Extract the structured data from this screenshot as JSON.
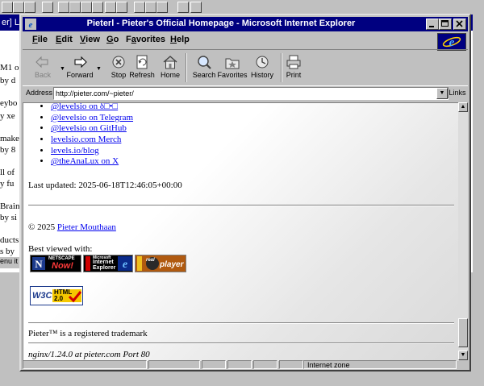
{
  "window": {
    "title": "Pieterl - Pieter's Official Homepage - Microsoft Internet Explorer"
  },
  "background": {
    "title_fragment": "er] Li",
    "lines": [
      "M1 o",
      "by d",
      "eybo",
      "y xe",
      "make",
      "by 8",
      "ll of",
      "y fu",
      "Brain",
      "by si",
      "ducts",
      "s by"
    ],
    "taskbar_text": "enu it"
  },
  "menu": {
    "items": [
      "File",
      "Edit",
      "View",
      "Go",
      "Favorites",
      "Help"
    ],
    "accel": [
      "F",
      "E",
      "V",
      "G",
      "a",
      "H"
    ]
  },
  "toolbar": {
    "back": "Back",
    "forward": "Forward",
    "stop": "Stop",
    "refresh": "Refresh",
    "home": "Home",
    "search": "Search",
    "favorites": "Favorites",
    "history": "History",
    "print": "Print"
  },
  "address": {
    "label": "Address",
    "value": "http://pieter.com/~pieter/",
    "links_label": "Links"
  },
  "page": {
    "links": [
      "@levelsio on δ□•□",
      "@levelsio on Telegram",
      "@levelsio on GitHub",
      "levelsio.com Merch",
      "levels.io/blog",
      "@theAnaLux on X"
    ],
    "last_updated": "Last updated: 2025-06-18T12:46:05+00:00",
    "copyright_prefix": "© 2025 ",
    "copyright_link": "Pieter Mouthaan",
    "best_viewed": "Best viewed with:",
    "badges": {
      "netscape_top": "NETSCAPE",
      "netscape_main": "Now!",
      "ie_top": "Microsoft",
      "ie_main1": "Internet",
      "ie_main2": "Explorer",
      "real_top": "real",
      "real_main": "player",
      "w3c": "W3C",
      "html_version": "HTML 2.0"
    },
    "trademark": "Pieter™ is a registered trademark",
    "server": "nginx/1.24.0 at pieter.com Port 80"
  },
  "status": {
    "zone": "Internet zone"
  },
  "colors": {
    "titlebar": "#000080",
    "link": "#0000ee",
    "chrome": "#c0c0c0"
  }
}
